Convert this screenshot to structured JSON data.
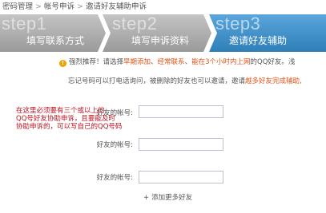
{
  "breadcrumb": {
    "items": [
      "密码管理",
      "帐号申诉",
      "邀请好友辅助申诉"
    ],
    "separator": ">"
  },
  "steps": [
    {
      "num": "step1",
      "title": "填写联系方式",
      "state": "done"
    },
    {
      "num": "step2",
      "title": "填写申诉资料",
      "state": "done"
    },
    {
      "num": "step3",
      "title": "邀请好友辅助",
      "state": "active"
    }
  ],
  "tip": {
    "icon": "warning-icon",
    "prefix": "强烈推荐！请选择",
    "hl1": "早期添加",
    "sep1": "、",
    "hl2": "经常联系",
    "sep2": "、",
    "hl3": "能在3个小时内上网",
    "suffix": "的QQ好友。浅"
  },
  "note": {
    "text": "忘记号码可以打电话询问，被删除的好友也可以邀请，邀请",
    "hl": "越多好友完成辅助,"
  },
  "overlay_lines": [
    "在这里必须要有三个或以上的",
    "QQ号好友协助申诉，且要能及时",
    "协助申诉的，可以写自己的QQ号码"
  ],
  "form": {
    "fields": [
      {
        "label": "好友的帐号:",
        "value": ""
      },
      {
        "label": "好友的帐号:",
        "value": ""
      },
      {
        "label": "好友的帐号:",
        "value": ""
      }
    ],
    "add_more": "添加更多好友",
    "add_icon": "+"
  },
  "colors": {
    "step_done": "#a9a9a9",
    "step_active": "#3c8fc8",
    "highlight": "#e2541a",
    "overlay_text": "#c1121f",
    "input_border": "#b8c4d4"
  }
}
